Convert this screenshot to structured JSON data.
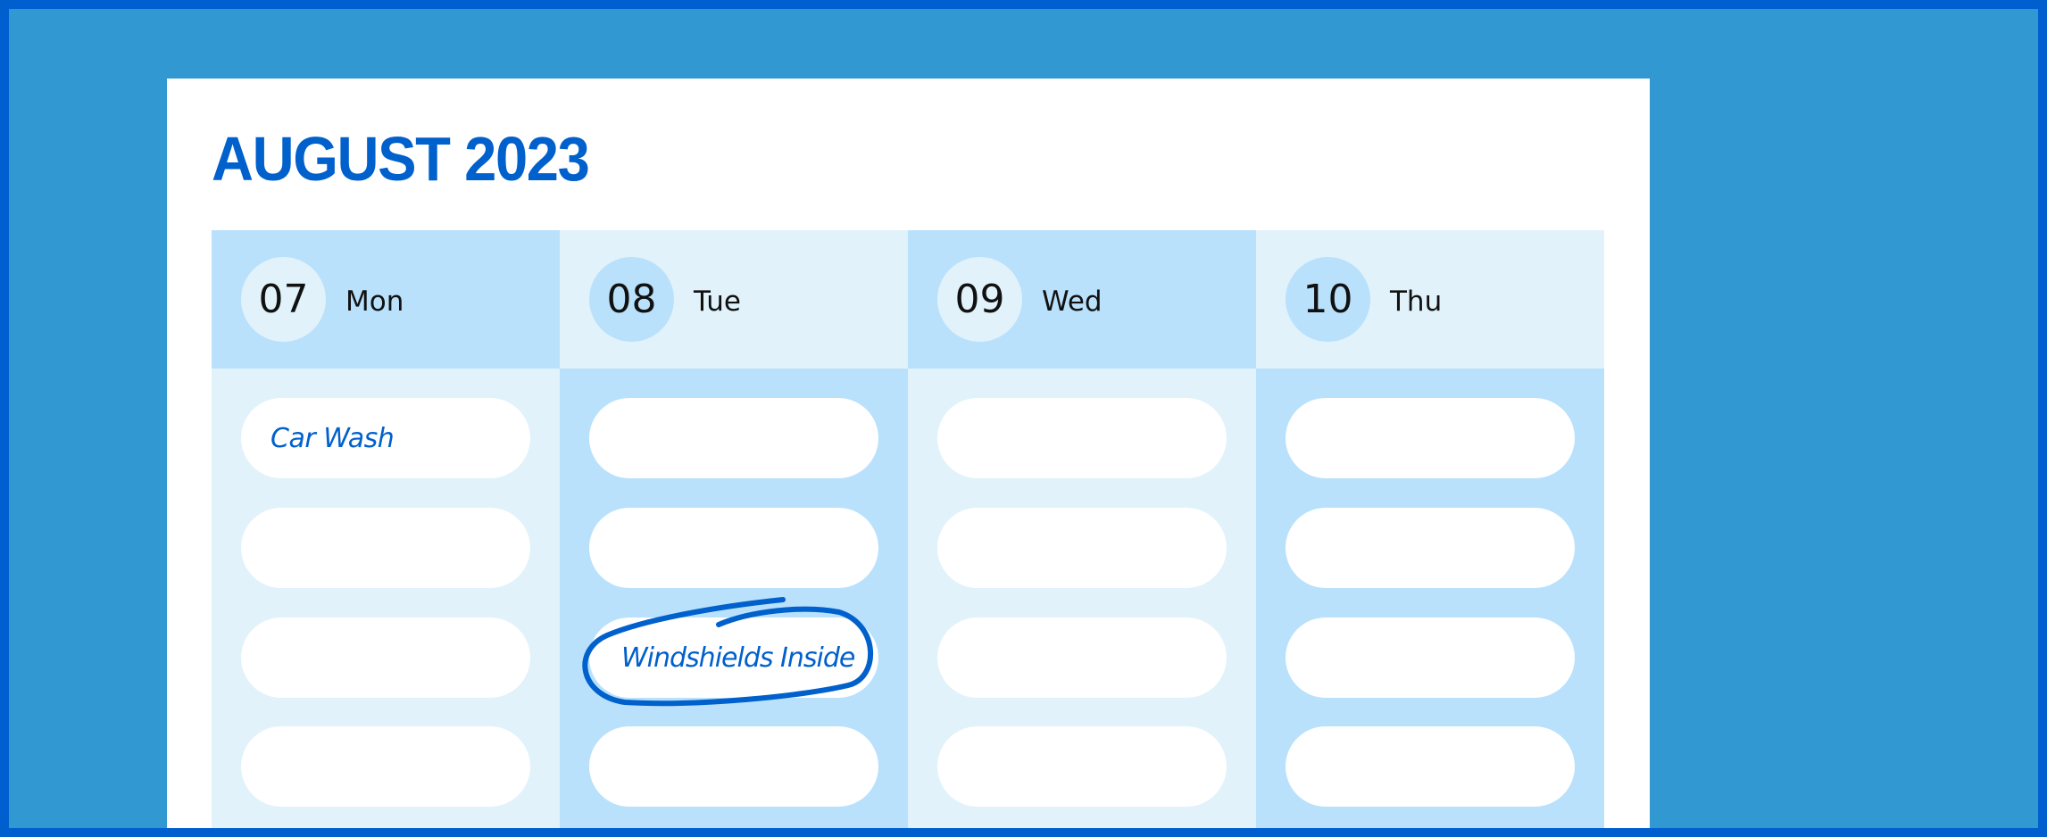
{
  "calendar": {
    "title": "AUGUST 2023",
    "days": [
      {
        "date": "07",
        "weekday": "Mon",
        "entries": [
          "Car Wash",
          "",
          "",
          ""
        ]
      },
      {
        "date": "08",
        "weekday": "Tue",
        "entries": [
          "",
          "",
          "Windshields Inside",
          ""
        ],
        "circled_entry": "Windshields Inside"
      },
      {
        "date": "09",
        "weekday": "Wed",
        "entries": [
          "",
          "",
          "",
          ""
        ]
      },
      {
        "date": "10",
        "weekday": "Thu",
        "entries": [
          "",
          "",
          "",
          ""
        ]
      }
    ]
  },
  "colors": {
    "frame_border": "#005fcf",
    "background": "#3198d2",
    "accent": "#0060cc",
    "cell_dark": "#b9e1fc",
    "cell_light": "#e1f2fb"
  }
}
